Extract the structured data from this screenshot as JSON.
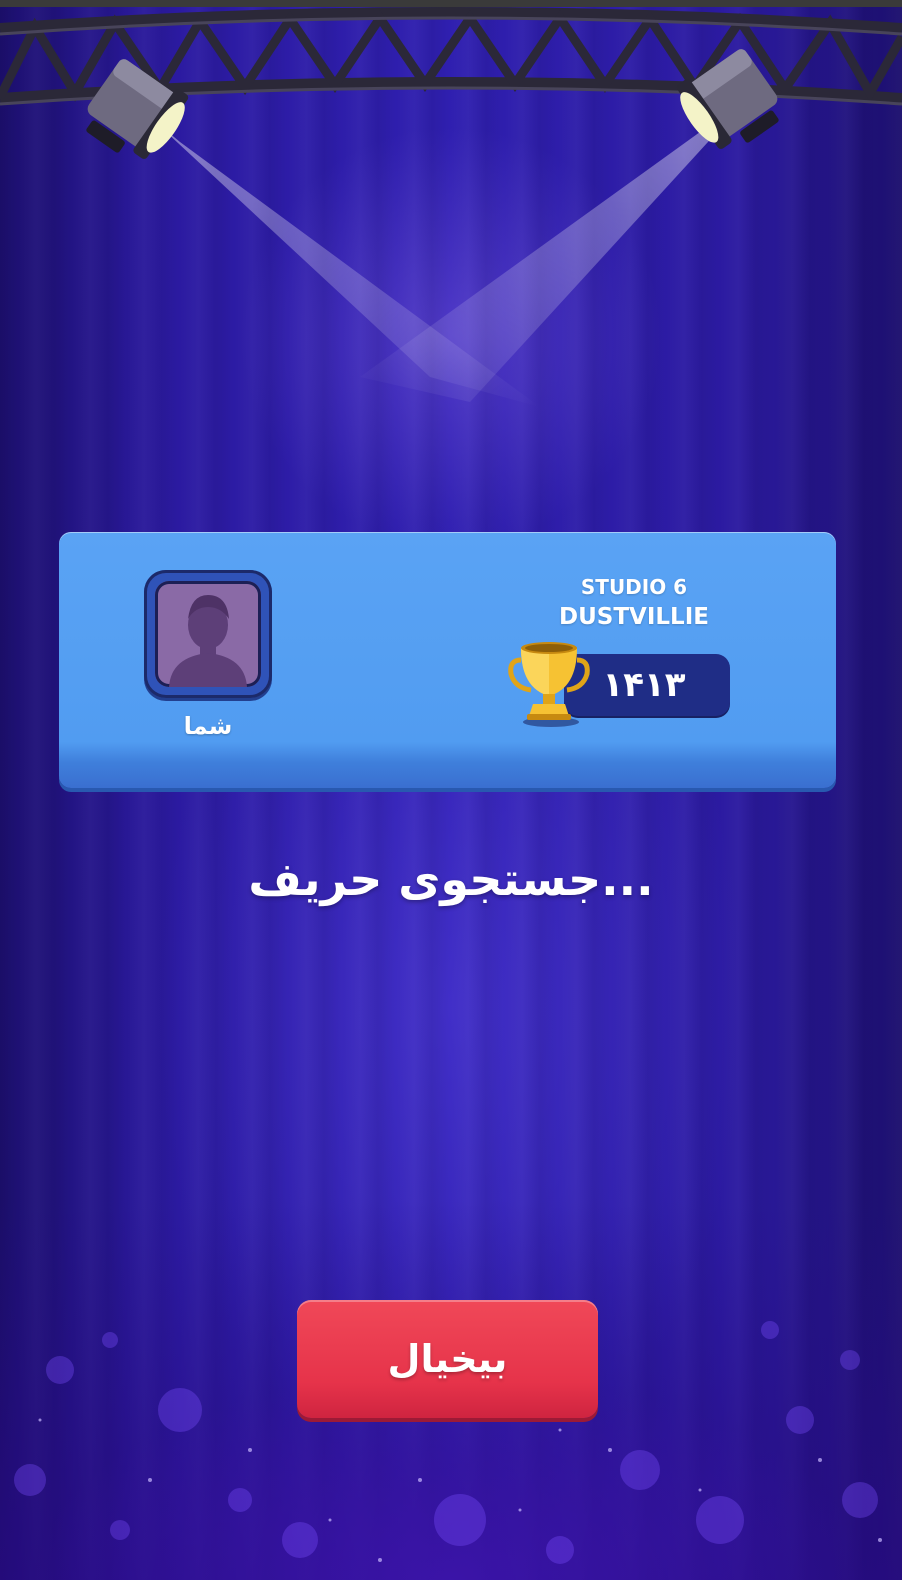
{
  "match": {
    "you_label": "شما",
    "opponent_name_line1": "STUDIO 6",
    "opponent_name_line2": "DUSTVILLIE",
    "opponent_trophies": "۱۴۱۳"
  },
  "status_text": "جستجوی حریف...",
  "cancel_label": "بیخیال",
  "icons": {
    "avatar": "person-silhouette-icon",
    "trophy": "trophy-icon",
    "spotlight": "spotlight-icon"
  },
  "colors": {
    "card": "#519cf1",
    "score_pill": "#1f2d86",
    "cancel_button": "#e6334a",
    "background": "#2f1fb0"
  }
}
